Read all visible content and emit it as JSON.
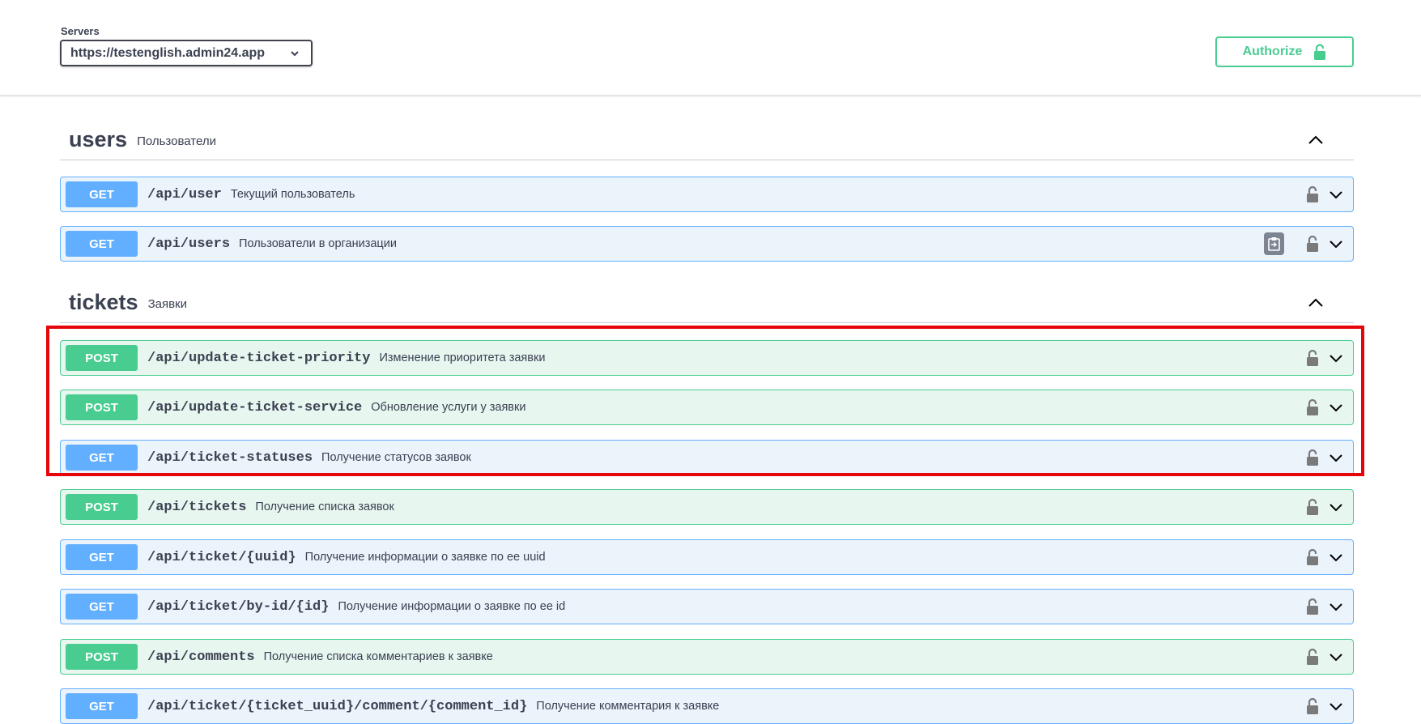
{
  "topbar": {
    "servers_label": "Servers",
    "selected_server": "https://testenglish.admin24.app",
    "authorize_label": "Authorize"
  },
  "colors": {
    "get": "#61affe",
    "post": "#49cc90",
    "highlight": "#e5050b"
  },
  "tags": [
    {
      "name": "users",
      "description": "Пользователи",
      "operations": [
        {
          "method": "GET",
          "path": "/api/user",
          "summary": "Текущий пользователь"
        },
        {
          "method": "GET",
          "path": "/api/users",
          "summary": "Пользователи в организации"
        }
      ]
    },
    {
      "name": "tickets",
      "description": "Заявки",
      "operations": [
        {
          "method": "POST",
          "path": "/api/update-ticket-priority",
          "summary": "Изменение приоритета заявки"
        },
        {
          "method": "POST",
          "path": "/api/update-ticket-service",
          "summary": "Обновление услуги у заявки"
        },
        {
          "method": "GET",
          "path": "/api/ticket-statuses",
          "summary": "Получение статусов заявок"
        },
        {
          "method": "POST",
          "path": "/api/tickets",
          "summary": "Получение списка заявок"
        },
        {
          "method": "GET",
          "path": "/api/ticket/{uuid}",
          "summary": "Получение информации о заявке по ее uuid"
        },
        {
          "method": "GET",
          "path": "/api/ticket/by-id/{id}",
          "summary": "Получение информации о заявке по ее id"
        },
        {
          "method": "POST",
          "path": "/api/comments",
          "summary": "Получение списка комментариев к заявке"
        },
        {
          "method": "GET",
          "path": "/api/ticket/{ticket_uuid}/comment/{comment_id}",
          "summary": "Получение комментария к заявке"
        }
      ]
    }
  ]
}
